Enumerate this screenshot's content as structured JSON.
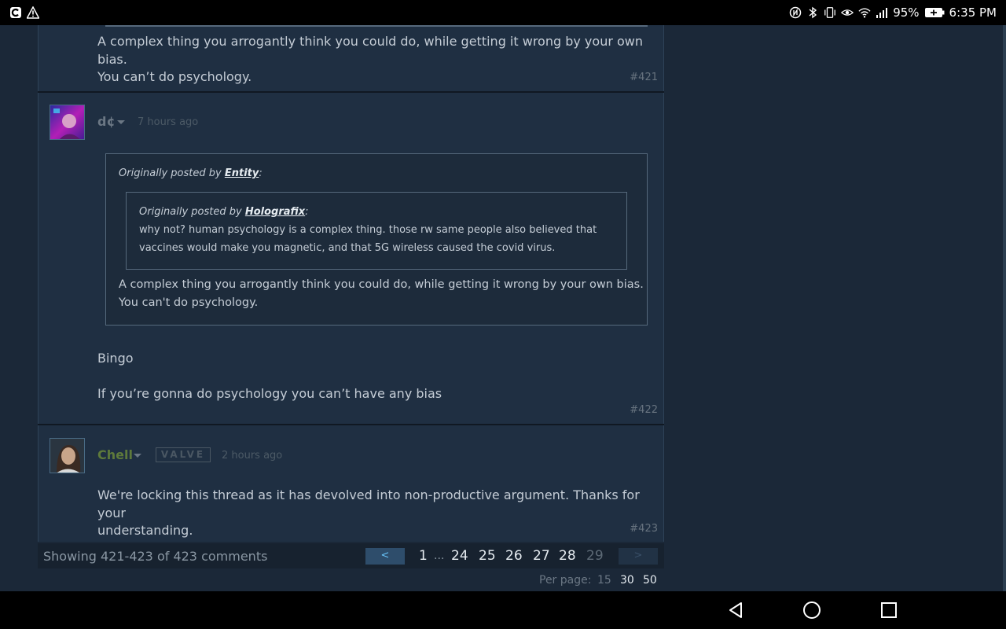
{
  "status_bar": {
    "left_icons": [
      "c-app-icon",
      "warning-icon"
    ],
    "right_icons": [
      "nfc-icon",
      "bluetooth-icon",
      "vibrate-icon",
      "eye-comfort-icon",
      "wifi-icon",
      "signal-icon"
    ],
    "battery": "95%",
    "time": "6:35 PM"
  },
  "comments": [
    {
      "text_lines": [
        "A complex thing you arrogantly think you could do, while getting it wrong by your own bias.",
        "You can’t do psychology."
      ],
      "number": "#421"
    },
    {
      "author": "d¢",
      "timestamp": "7 hours ago",
      "quote": {
        "head_prefix": "Originally posted by ",
        "author": "Entity",
        "suffix": ":",
        "inner": {
          "head_prefix": "Originally posted by ",
          "author": "Holografix",
          "suffix": ":",
          "lines": [
            "why not? human psychology is a complex thing. those rw same people also believed that",
            "vaccines would make you magnetic, and that 5G wireless caused the covid virus."
          ]
        },
        "lines": [
          "A complex thing you arrogantly think you could do, while getting it wrong by your own bias.",
          "You can't do psychology."
        ]
      },
      "body_lines": [
        "Bingo",
        "If you’re gonna do psychology you can’t have any bias"
      ],
      "number": "#422"
    },
    {
      "author": "Chell",
      "badge": "VALVE",
      "timestamp": "2 hours ago",
      "text_lines": [
        "We're locking this thread as it has devolved into non-productive argument. Thanks for your",
        "understanding."
      ],
      "number": "#423"
    }
  ],
  "pager": {
    "summary": "Showing 421-423 of 423 comments",
    "prev": "<",
    "next": ">",
    "pages": [
      "1",
      "24",
      "25",
      "26",
      "27",
      "28",
      "29"
    ],
    "ellipsis": "...",
    "current_page": "29"
  },
  "per_page": {
    "label": "Per page:",
    "options": [
      "15",
      "30",
      "50"
    ]
  }
}
